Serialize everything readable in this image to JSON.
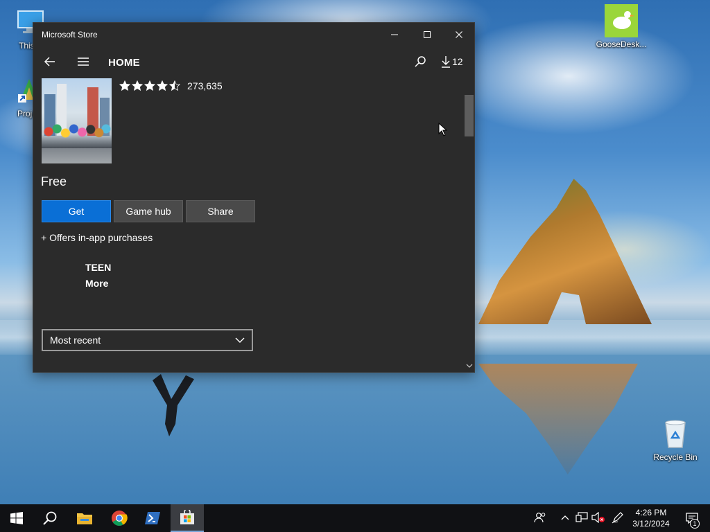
{
  "desktop": {
    "icons": [
      {
        "label": "This P",
        "icon": "computer-icon"
      },
      {
        "label": "Projec",
        "icon": "project-shortcut-icon"
      },
      {
        "label": "GooseDesk...",
        "icon": "goose-icon"
      },
      {
        "label": "Recycle Bin",
        "icon": "recycle-bin-icon"
      }
    ]
  },
  "window": {
    "title": "Microsoft Store",
    "controls": {
      "minimize": "minimize-icon",
      "maximize": "maximize-icon",
      "close": "close-icon"
    }
  },
  "nav": {
    "page_title": "HOME",
    "downloads_count": "12"
  },
  "app": {
    "rating_value": 4.5,
    "rating_count": "273,635",
    "price": "Free",
    "buttons": {
      "get": "Get",
      "game_hub": "Game hub",
      "share": "Share"
    },
    "in_app_note": "+ Offers in-app purchases",
    "age_rating": "TEEN",
    "more_link": "More"
  },
  "reviews": {
    "sort_selected": "Most recent"
  },
  "taskbar": {
    "time": "4:26 PM",
    "date": "3/12/2024",
    "notification_count": "1"
  },
  "colors": {
    "accent": "#0a6fd6",
    "window_bg": "#2b2b2b",
    "taskbar_bg": "#101114"
  }
}
